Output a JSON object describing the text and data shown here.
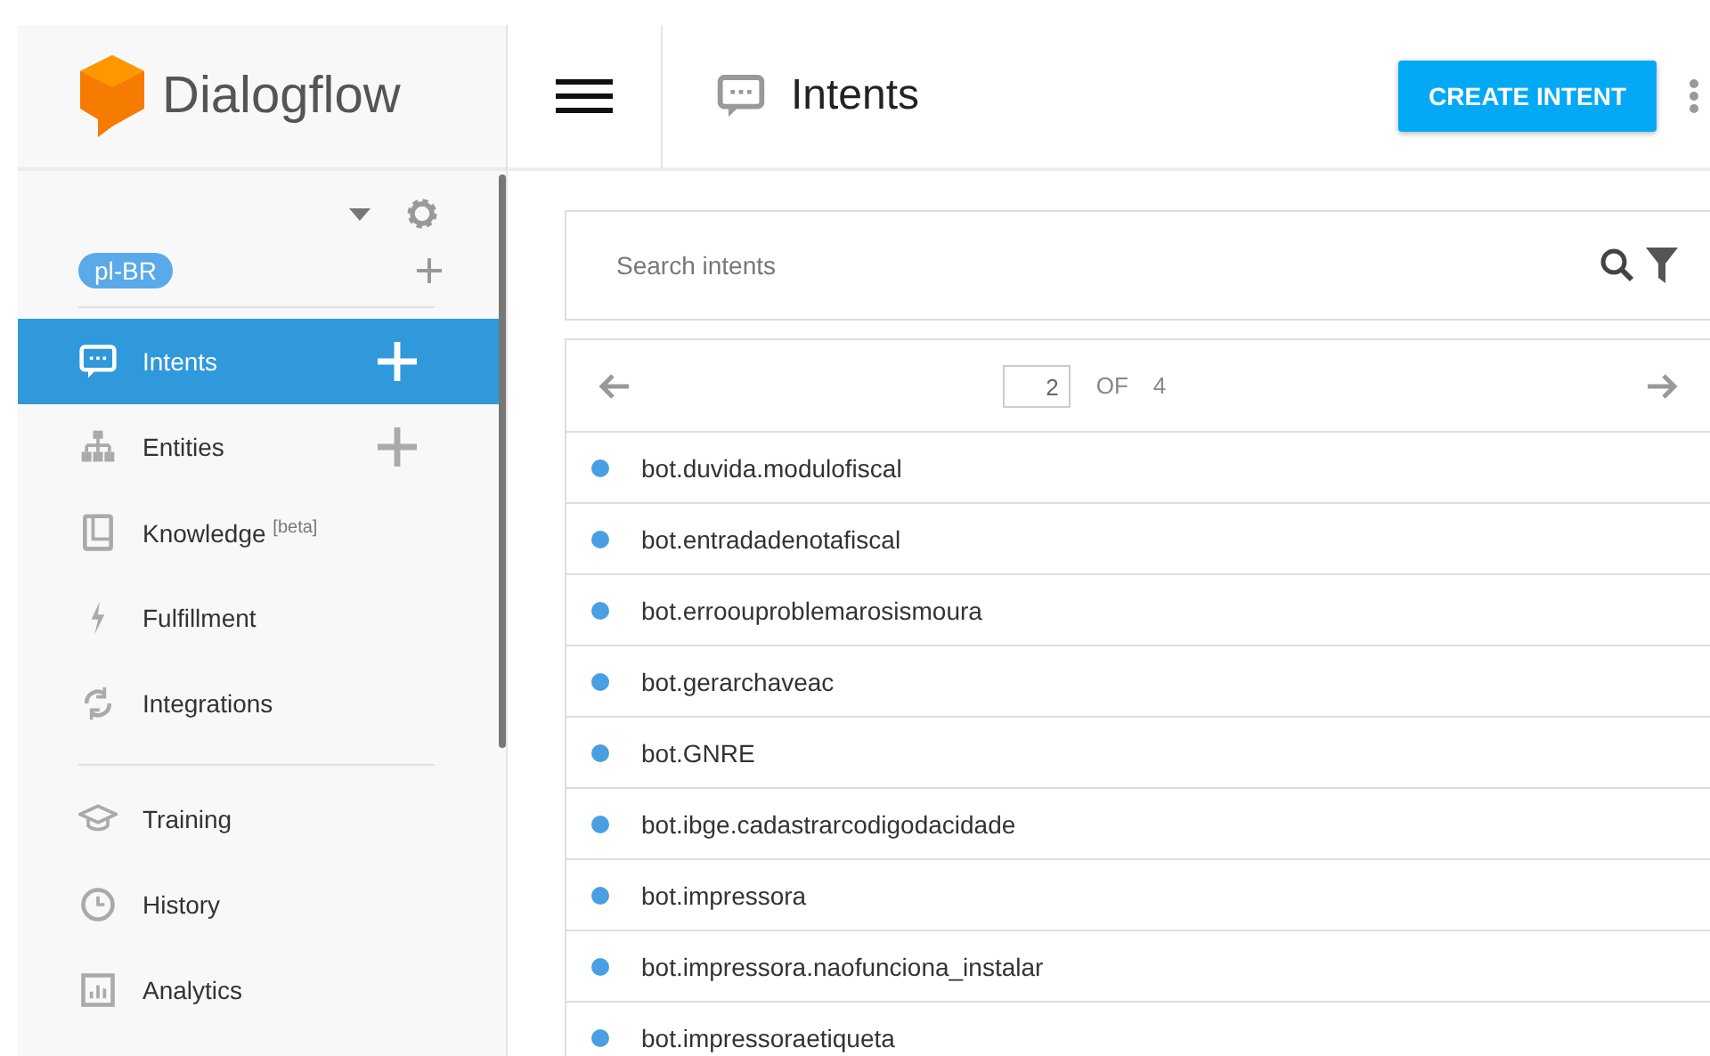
{
  "brand": {
    "name": "Dialogflow"
  },
  "header": {
    "title": "Intents",
    "action": "CREATE INTENT"
  },
  "sidebar": {
    "language": "pl-BR",
    "nav_groups": [
      [
        {
          "label": "Intents",
          "selected": true,
          "add": true
        },
        {
          "label": "Entities",
          "selected": false,
          "add": true
        },
        {
          "label": "Knowledge",
          "badge": "[beta]",
          "selected": false,
          "add": false
        },
        {
          "label": "Fulfillment",
          "selected": false,
          "add": false
        },
        {
          "label": "Integrations",
          "selected": false,
          "add": false
        }
      ],
      [
        {
          "label": "Training",
          "selected": false,
          "add": false
        },
        {
          "label": "History",
          "selected": false,
          "add": false
        },
        {
          "label": "Analytics",
          "selected": false,
          "add": false
        }
      ]
    ]
  },
  "search": {
    "placeholder": "Search intents"
  },
  "pagination": {
    "page": "2",
    "of": "OF",
    "total": "4"
  },
  "intents": [
    {
      "name": "bot.duvida.modulofiscal",
      "color": "#4a9fe3"
    },
    {
      "name": "bot.entradadenotafiscal",
      "color": "#4a9fe3"
    },
    {
      "name": "bot.erroouproblemarosismoura",
      "color": "#4a9fe3"
    },
    {
      "name": "bot.gerarchaveac",
      "color": "#4a9fe3"
    },
    {
      "name": "bot.GNRE",
      "color": "#4a9fe3"
    },
    {
      "name": "bot.ibge.cadastrarcodigodacidade",
      "color": "#4a9fe3"
    },
    {
      "name": "bot.impressora",
      "color": "#4a9fe3"
    },
    {
      "name": "bot.impressora.naofunciona_instalar",
      "color": "#4a9fe3"
    },
    {
      "name": "bot.impressoraetiqueta",
      "color": "#4a9fe3"
    }
  ]
}
